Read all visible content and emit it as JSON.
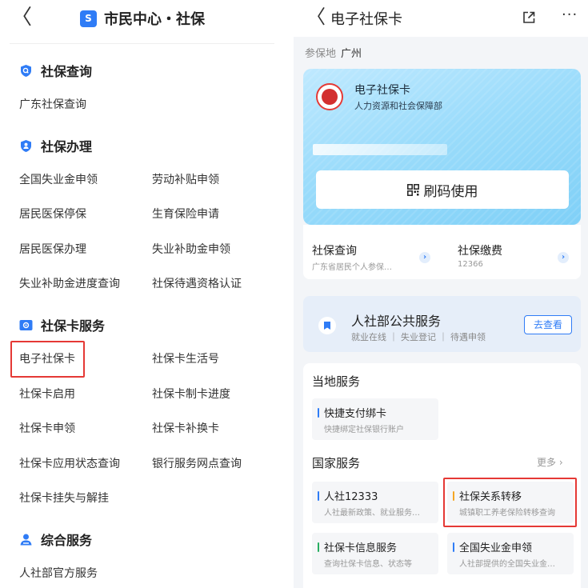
{
  "left": {
    "back_glyph": "〈",
    "title_logo": "S",
    "title": "市民中心・社保",
    "sections": [
      {
        "title": "社保查询",
        "icon": "search-shield-icon",
        "items": [
          "广东社保查询"
        ]
      },
      {
        "title": "社保办理",
        "icon": "user-shield-icon",
        "items": [
          "全国失业金申领",
          "劳动补贴申领",
          "居民医保停保",
          "生育保险申请",
          "居民医保办理",
          "失业补助金申领",
          "失业补助金进度查询",
          "社保待遇资格认证"
        ]
      },
      {
        "title": "社保卡服务",
        "icon": "card-icon",
        "items": [
          "电子社保卡",
          "社保卡生活号",
          "社保卡启用",
          "社保卡制卡进度",
          "社保卡申领",
          "社保卡补换卡",
          "社保卡应用状态查询",
          "银行服务网点查询",
          "社保卡挂失与解挂"
        ]
      },
      {
        "title": "综合服务",
        "icon": "people-icon",
        "items": [
          "人社部官方服务"
        ]
      }
    ]
  },
  "right": {
    "back_glyph": "〈",
    "title": "电子社保卡",
    "more_glyph": "···",
    "location": {
      "label": "参保地",
      "value": "广州"
    },
    "card": {
      "title": "电子社保卡",
      "subtitle": "人力资源和社会保障部",
      "scan_label": "刷码使用"
    },
    "quick": [
      {
        "title": "社保查询",
        "subtitle": "广东省居民个人参保…"
      },
      {
        "title": "社保缴费",
        "subtitle": "12366"
      }
    ],
    "public": {
      "title": "人社部公共服务",
      "subtitle": "就业在线 ｜ 失业登记 ｜ 待遇申领",
      "button": "去查看"
    },
    "local": {
      "heading": "当地服务",
      "tiles": [
        {
          "title": "快捷支付绑卡",
          "subtitle": "快捷绑定社保银行账户",
          "color": "#2f7cf6"
        }
      ]
    },
    "national": {
      "heading": "国家服务",
      "more": "更多 ›",
      "tiles": [
        {
          "title": "人社12333",
          "subtitle": "人社最新政策、就业服务…",
          "color": "#2f7cf6"
        },
        {
          "title": "社保关系转移",
          "subtitle": "城镇职工养老保险转移查询",
          "color": "#f5a623"
        },
        {
          "title": "社保卡信息服务",
          "subtitle": "查询社保卡信息、状态等",
          "color": "#27ae60"
        },
        {
          "title": "全国失业金申领",
          "subtitle": "人社部提供的全国失业金…",
          "color": "#2f7cf6"
        }
      ]
    }
  }
}
